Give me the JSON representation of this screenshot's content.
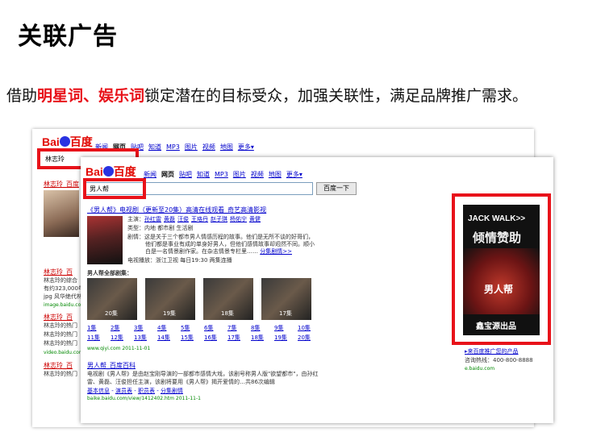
{
  "header": {
    "title": "关联广告",
    "subtitle_prefix": "借助",
    "subtitle_highlight": "明星词、娱乐词",
    "subtitle_suffix": "锁定潜在的目标受众，加强关联性，满足品牌推广需求。"
  },
  "back_page": {
    "logo_left": "Bai",
    "logo_right": "百度",
    "nav": [
      "新闻",
      "网页",
      "贴吧",
      "知道",
      "MP3",
      "图片",
      "视频",
      "地图",
      "更多▾"
    ],
    "nav_current": 1,
    "query": "林志玲",
    "results": [
      {
        "title": "林志玲_百度",
        "lines": []
      },
      {
        "title": "林志玲_百",
        "lines": [
          "林志玲的综合",
          "有约323,000年",
          "jpg 风华绝代林",
          "image.baidu.com"
        ]
      },
      {
        "title": "林志玲_百",
        "lines": [
          "林志玲的热门",
          "林志玲的热门",
          "林志玲的热门",
          "video.baidu.com"
        ]
      },
      {
        "title": "林志玲_百",
        "lines": [
          "林志玲的热门"
        ]
      }
    ]
  },
  "front_page": {
    "logo_left": "Bai",
    "logo_right": "百度",
    "nav": [
      "新闻",
      "网页",
      "贴吧",
      "知道",
      "MP3",
      "图片",
      "视频",
      "地图",
      "更多▾"
    ],
    "nav_current": 1,
    "query": "男人帮",
    "search_button": "百度一下",
    "result1": {
      "title": "《男人帮》电视剧（更新至20集）高清在线观看_奇艺高清影视",
      "cast_label": "主演：",
      "cast": [
        "孙红雷",
        "黄磊",
        "汪俊",
        "王珞丹",
        "赵子琪",
        "杨佑宁",
        "黄健"
      ],
      "type": "类型：内地 都市剧 生活剧",
      "plot_l1": "剧情：这是关于三个都市男人情感历程的故事。他们是无所不谈的好哥们，",
      "plot_l2": "他们都是事业有成的单身好男人，但他们感情故事却迥然不同。顺小",
      "plot_l3": "白是一名情景剧作家。在杂志情景专栏里……",
      "plot_more": "分集剧情>>",
      "airtime": "电视播放：浙江卫视 每日19:30 两集连播",
      "episodes_heading": "男人帮全部剧集：",
      "thumbs": [
        "20集",
        "19集",
        "18集",
        "17集"
      ],
      "episodes": [
        "1集",
        "2集",
        "3集",
        "4集",
        "5集",
        "6集",
        "7集",
        "8集",
        "9集",
        "10集",
        "11集",
        "12集",
        "13集",
        "14集",
        "15集",
        "16集",
        "17集",
        "18集",
        "19集",
        "20集"
      ],
      "url": "www.qiyi.com 2011-11-01"
    },
    "result2": {
      "title": "男人帮_百度百科",
      "snippet_l1": "电视剧《男人帮》是由赵宝刚导演的一部都市感情大戏，该剧号称男人版\"欲望都市\"，由孙红",
      "snippet_l2": "雷、黄磊、汪俊担任主演，该剧将要用《男人帮》揭开爱情的…共86次编辑",
      "links": [
        "基本信息",
        "演员表",
        "职员表",
        "分集剧情"
      ],
      "url": "baike.baidu.com/view/1412402.htm 2011-11-1"
    },
    "ad": {
      "brand": "JACK WALK>>",
      "slogan": "倾情赞助",
      "show_title": "男人帮",
      "footer": "鑫宝源出品",
      "promo_link": "▸来百度推广您的产品",
      "hotline": "咨询热线：400-800-8888",
      "ad_url": "e.baidu.com"
    }
  },
  "colors": {
    "highlight_red": "#e8121a",
    "link_blue": "#0000cc",
    "url_green": "#008000"
  }
}
